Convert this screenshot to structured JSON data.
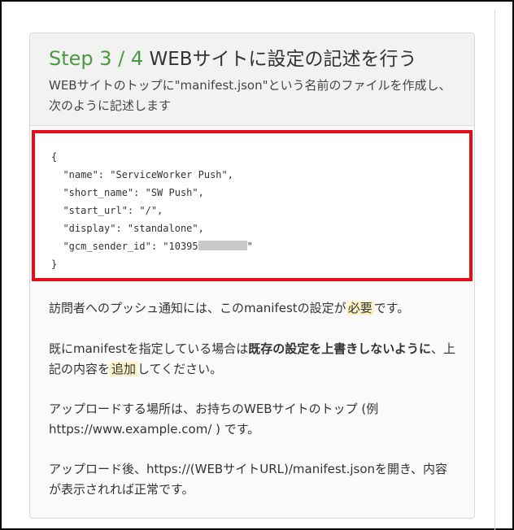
{
  "card": {
    "step_label": "Step 3",
    "step_separator": " / ",
    "step_total": "4",
    "title": "WEBサイトに設定の記述を行う",
    "subtitle": "WEBサイトのトップに\"manifest.json\"という名前のファイルを作成し、次のように記述します"
  },
  "code": {
    "open": "{",
    "line_name": "  \"name\": \"ServiceWorker Push\",",
    "line_short_name": "  \"short_name\": \"SW Push\",",
    "line_start_url": "  \"start_url\": \"/\",",
    "line_display": "  \"display\": \"standalone\",",
    "line_gcm_prefix": "  \"gcm_sender_id\": \"10395",
    "line_gcm_suffix": "\"",
    "close": "}"
  },
  "body": {
    "p1_before": "訪問者へのプッシュ通知には、このmanifestの設定が",
    "p1_highlight": "必要",
    "p1_after": "です。",
    "p2_before": "既にmanifestを指定している場合は",
    "p2_bold": "既存の設定を上書きしないように",
    "p2_middle": "、上記の内容を",
    "p2_highlight": "追加",
    "p2_after": "してください。",
    "p3": "アップロードする場所は、お持ちのWEBサイトのトップ (例 https://www.example.com/ ) です。",
    "p4": "アップロード後、https://(WEBサイトURL)/manifest.jsonを開き、内容が表示されれば正常です。"
  },
  "colors": {
    "accent_green": "#4a9a3f",
    "code_border_red": "#e50d1a",
    "highlight": "#fdf3c9"
  }
}
